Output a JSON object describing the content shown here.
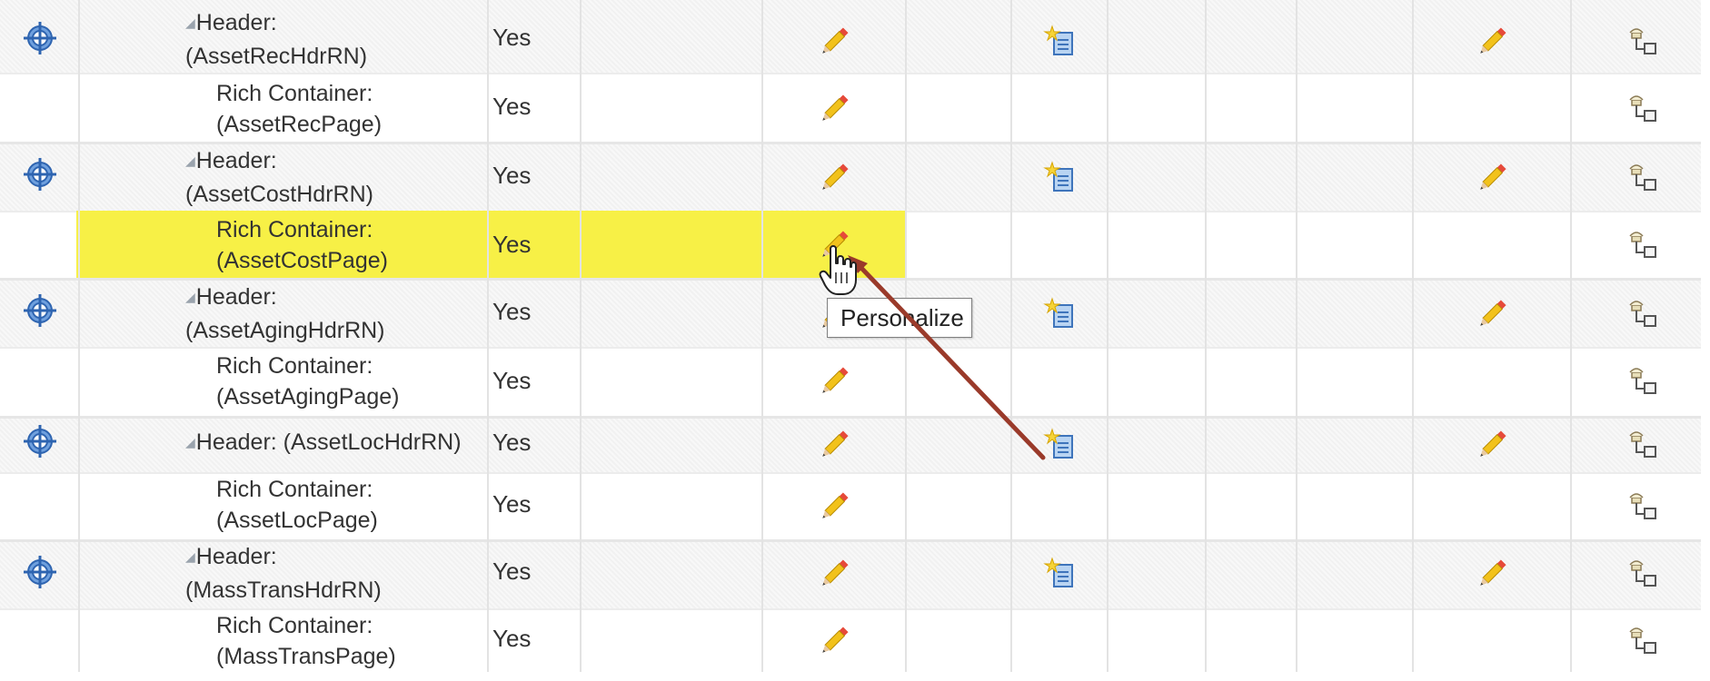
{
  "rows": [
    {
      "type": "header",
      "name_line1": "Header:",
      "name_line2": "(AssetRecHdrRN)",
      "value": "Yes"
    },
    {
      "type": "container",
      "name_line1": "Rich Container:",
      "name_line2": "(AssetRecPage)",
      "value": "Yes"
    },
    {
      "type": "header",
      "name_line1": "Header:",
      "name_line2": "(AssetCostHdrRN)",
      "value": "Yes"
    },
    {
      "type": "container",
      "name_line1": "Rich Container:",
      "name_line2": "(AssetCostPage)",
      "value": "Yes",
      "highlighted": true
    },
    {
      "type": "header",
      "name_line1": "Header:",
      "name_line2": "(AssetAgingHdrRN)",
      "value": "Yes"
    },
    {
      "type": "container",
      "name_line1": "Rich Container:",
      "name_line2": "(AssetAgingPage)",
      "value": "Yes"
    },
    {
      "type": "header",
      "name_line1": "Header: (AssetLocHdrRN)",
      "value": "Yes"
    },
    {
      "type": "container",
      "name_line1": "Rich Container:",
      "name_line2": "(AssetLocPage)",
      "value": "Yes"
    },
    {
      "type": "header",
      "name_line1": "Header:",
      "name_line2": "(MassTransHdrRN)",
      "value": "Yes"
    },
    {
      "type": "container",
      "name_line1": "Rich Container:",
      "name_line2": "(MassTransPage)",
      "value": "Yes"
    }
  ],
  "tooltip": {
    "text": "Personalize"
  },
  "icons": {
    "move": "crosshair-move-icon",
    "personalize": "pencil-icon",
    "create": "new-item-icon",
    "reorder": "hierarchy-icon"
  },
  "colors": {
    "highlight": "#f7f046",
    "arrow": "#9a3a2a",
    "move_icon": "#3f78c6",
    "pencil_body": "#f2c21b"
  }
}
